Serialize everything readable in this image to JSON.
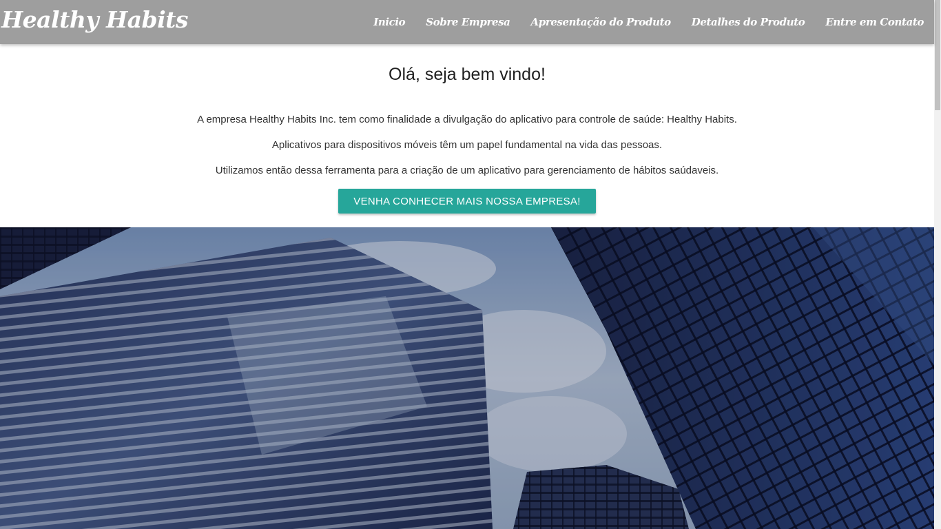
{
  "navbar": {
    "brand": "Healthy Habits",
    "links": [
      {
        "label": "Inicio"
      },
      {
        "label": "Sobre Empresa"
      },
      {
        "label": "Apresentação do Produto"
      },
      {
        "label": "Detalhes do Produto"
      },
      {
        "label": "Entre em Contato"
      }
    ],
    "background_color": "#9e9e9e"
  },
  "intro": {
    "heading": "Olá, seja bem vindo!",
    "paragraphs": [
      "A empresa Healthy Habits Inc. tem como finalidade a divulgação do aplicativo para controle de saúde: Healthy Habits.",
      "Aplicativos para dispositivos móveis têm um papel fundamental na vida das pessoas.",
      "Utilizamos então dessa ferramenta para a criação de um aplicativo para gerenciamento de hábitos saúdaveis."
    ],
    "cta_label": "VENHA CONHECER MAIS NOSSA EMPRESA!",
    "cta_color": "#26a69a"
  },
  "hero": {
    "icon": "office-buildings-photo"
  }
}
